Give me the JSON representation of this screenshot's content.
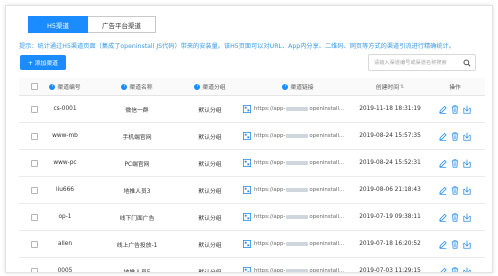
{
  "tabs": [
    {
      "label": "H5渠道",
      "active": true
    },
    {
      "label": "广告平台渠道",
      "active": false
    }
  ],
  "notice": "提示：统计通过H5渠道页面（集成了openinstall JS代码）带来的安装量。该H5页面可以对URL、App内分享、二维码、网页等方式的渠道引流进行精确统计。",
  "toolbar": {
    "add_label": "+ 添加渠道",
    "search_placeholder": "请输入渠道编号或渠道名称搜索"
  },
  "table": {
    "headers": {
      "id": "渠道编号",
      "name": "渠道名称",
      "group": "渠道分组",
      "link": "渠道链接",
      "time": "创建时间",
      "ops": "操作"
    },
    "rows": [
      {
        "id": "cs-0001",
        "name": "微信一群",
        "group": "默认分组",
        "link_prefix": "https://app-",
        "link_suffix": "openinstall...",
        "time": "2019-11-18 18:31:19"
      },
      {
        "id": "www-mb",
        "name": "手机端官网",
        "group": "默认分组",
        "link_prefix": "https://app-",
        "link_suffix": "openinstall...",
        "time": "2019-08-24 15:57:35"
      },
      {
        "id": "www-pc",
        "name": "PC端官网",
        "group": "默认分组",
        "link_prefix": "https://app-",
        "link_suffix": "openinstall...",
        "time": "2019-08-24 15:52:31"
      },
      {
        "id": "liu666",
        "name": "地推人员3",
        "group": "默认分组",
        "link_prefix": "https://app-",
        "link_suffix": "openinstall...",
        "time": "2019-08-06 21:18:43"
      },
      {
        "id": "op-1",
        "name": "线下门面广告",
        "group": "默认分组",
        "link_prefix": "https://app-",
        "link_suffix": "openinstall...",
        "time": "2019-07-19 09:38:11"
      },
      {
        "id": "allen",
        "name": "线上广告投放-1",
        "group": "默认分组",
        "link_prefix": "https://app-",
        "link_suffix": "openinstall...",
        "time": "2019-07-18 16:20:52"
      },
      {
        "id": "0005",
        "name": "地推人员5",
        "group": "默认分组",
        "link_prefix": "https://app-",
        "link_suffix": "openinstall...",
        "time": "2019-07-03 11:29:15"
      }
    ]
  },
  "colors": {
    "accent": "#1a8cff",
    "notice": "#3a9be6",
    "op_icon": "#2b8ee8"
  }
}
